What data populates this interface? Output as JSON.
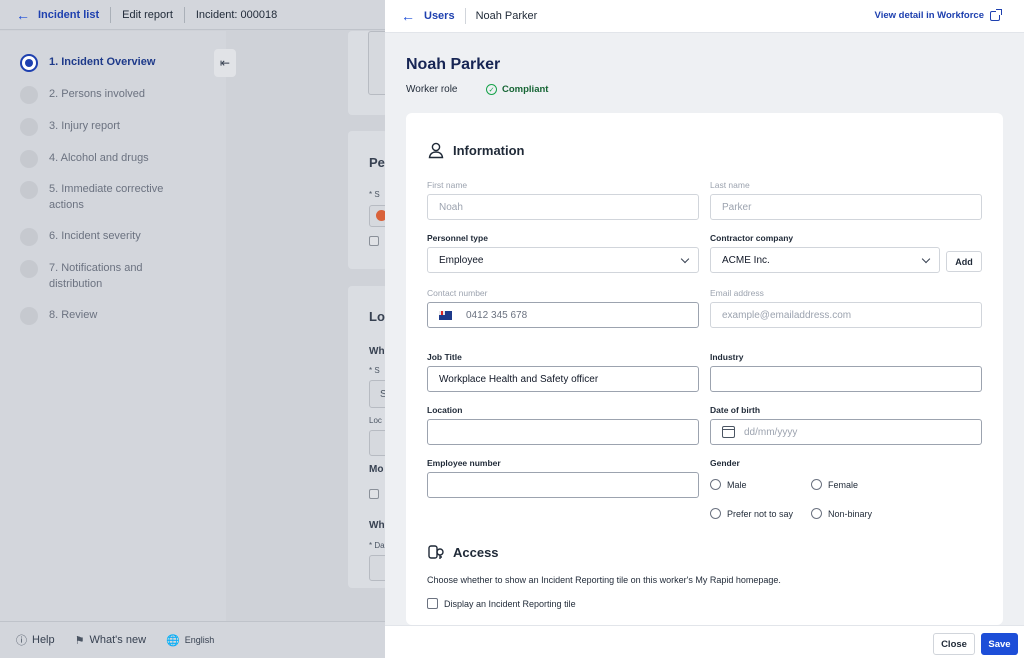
{
  "background": {
    "topbar": {
      "incident_list": "Incident list",
      "edit_report": "Edit report",
      "incident_id": "Incident: 000018"
    },
    "steps": [
      {
        "label": "1. Incident Overview",
        "active": true
      },
      {
        "label": "2. Persons involved",
        "active": false
      },
      {
        "label": "3. Injury report",
        "active": false
      },
      {
        "label": "4. Alcohol and drugs",
        "active": false
      },
      {
        "label": "5. Immediate corrective actions",
        "active": false
      },
      {
        "label": "6. Incident severity",
        "active": false
      },
      {
        "label": "7. Notifications and distribution",
        "active": false
      },
      {
        "label": "8. Review",
        "active": false
      }
    ],
    "fragments": {
      "pe": "Pe",
      "lo": "Lo",
      "wh1": "Wh",
      "s1": "* S",
      "s2": "S",
      "loc": "Loc",
      "mo": "Mo",
      "wh2": "Wh",
      "da": "* Da"
    },
    "footer": {
      "help": "Help",
      "whats_new": "What's new",
      "language": "English"
    }
  },
  "drawer": {
    "header": {
      "users": "Users",
      "name": "Noah Parker",
      "view_detail": "View detail in Workforce"
    },
    "person": {
      "name": "Noah Parker",
      "role": "Worker role",
      "status": "Compliant"
    },
    "information": {
      "title": "Information",
      "first_name_label": "First name",
      "first_name_value": "Noah",
      "last_name_label": "Last name",
      "last_name_value": "Parker",
      "personnel_type_label": "Personnel type",
      "personnel_type_value": "Employee",
      "contractor_label": "Contractor company",
      "contractor_value": "ACME Inc.",
      "add_label": "Add",
      "contact_label": "Contact number",
      "contact_value": "0412 345 678",
      "email_label": "Email address",
      "email_placeholder": "example@emailaddress.com",
      "job_title_label": "Job Title",
      "job_title_value": "Workplace Health and Safety officer",
      "industry_label": "Industry",
      "location_label": "Location",
      "dob_label": "Date of birth",
      "dob_placeholder": "dd/mm/yyyy",
      "employee_number_label": "Employee number",
      "gender_label": "Gender",
      "gender_options": [
        "Male",
        "Female",
        "Prefer not to say",
        "Non-binary"
      ]
    },
    "access": {
      "title": "Access",
      "description": "Choose whether to show an Incident Reporting tile on this worker's My Rapid homepage.",
      "checkbox_label": "Display an Incident Reporting tile"
    },
    "footer": {
      "close": "Close",
      "save": "Save"
    }
  },
  "colors": {
    "brand": "#1e40af",
    "primary_button": "#1d4ed8",
    "compliant": "#16a34a"
  }
}
